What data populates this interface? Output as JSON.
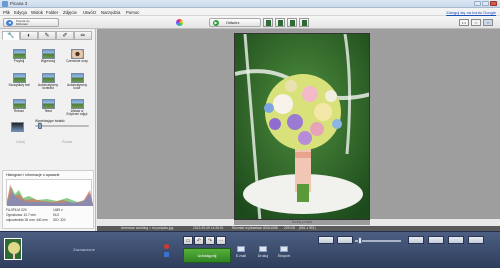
{
  "window": {
    "title": "Picasa 3"
  },
  "menu": {
    "items": [
      "Plik",
      "Edycja",
      "Widok",
      "Folder",
      "Zdjęcie",
      "Utwórz",
      "Narzędzia",
      "Pomoc"
    ],
    "login_link": "Zaloguj się na konto Google"
  },
  "toolbar": {
    "back_label": "Powrót do biblioteki",
    "play_label": "Odtwórz",
    "view_buttons": [
      "1:1",
      "▭",
      "▭"
    ]
  },
  "left_panel": {
    "tabs": [
      "wrench-icon",
      "contrast-icon",
      "brush-icon",
      "pen-icon",
      "paint-icon"
    ],
    "tools": [
      {
        "label": "Przytnij"
      },
      {
        "label": "Wyprostuj"
      },
      {
        "label": "Czerwone oczy"
      },
      {
        "label": "Szczęśliwy traf"
      },
      {
        "label": "Automatyczny kontrast"
      },
      {
        "label": "Automatyczny kolor"
      },
      {
        "label": "Retusz"
      },
      {
        "label": "Tekst"
      },
      {
        "label": "Wstaw w Edytorze zdjęć"
      }
    ],
    "fill_light_label": "Wypełniające światło",
    "fill_light_level": 0.05,
    "undo_label": "Cofnij",
    "redo_label": "Ponów",
    "histogram_title": "Histogram i informacje o aparacie",
    "exif": {
      "camera": "FUJIFILM X20",
      "resolution": "1489 x",
      "shutter": "Ogniskowa: 10.7 mm",
      "aperture": "f/4.0",
      "equiv": "odpowiednik 35 mm: 440 mm",
      "iso": "ISO: 320"
    }
  },
  "center": {
    "caption": "Dodaj podpis"
  },
  "statusbar": {
    "path": "American wedding > do podpisu.jpg",
    "date": "2013-09-09 14:26:51",
    "size_text": "Rozmiar w pikselach 800x1066",
    "filesize": "225 KB",
    "counter": "(551 z 551)"
  },
  "tray": {
    "label": "Zaznaczone",
    "upload_label": "Udostępnij",
    "share": [
      "E-mail",
      "Drukuj",
      "Eksport"
    ]
  }
}
